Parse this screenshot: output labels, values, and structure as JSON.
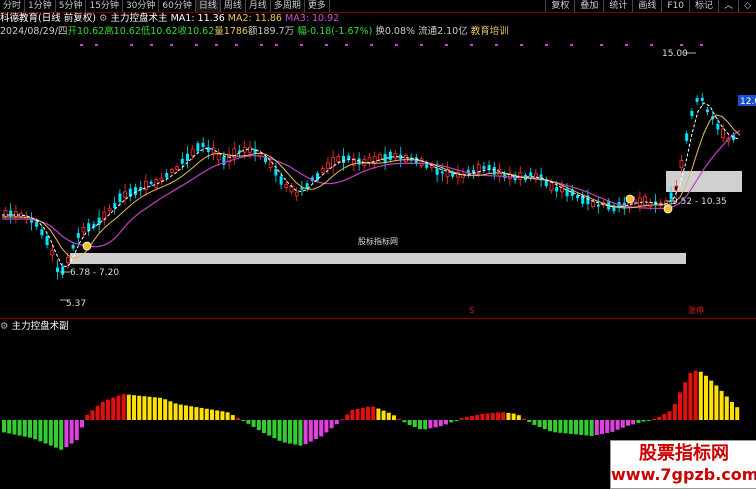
{
  "toolbar": {
    "periods": [
      "分时",
      "1分钟",
      "5分钟",
      "15分钟",
      "30分钟",
      "60分钟",
      "日线",
      "周线",
      "月线",
      "多周期",
      "更多"
    ],
    "active_period": "日线",
    "right_buttons": [
      "复权",
      "叠加",
      "统计",
      "画线",
      "F10",
      "标记"
    ],
    "right_icons": [
      "chevron-up-icon",
      "diamond-icon"
    ]
  },
  "header": {
    "stock_name": "科德教育",
    "mode": "(日线 前复权)",
    "indicator_name": "主力控盘术主",
    "ma1": "MA1: 11.36",
    "ma2": "MA2: 11.86",
    "ma3": "MA3: 10.92",
    "date": "2024/08/29/四",
    "open": "开10.62",
    "high": "高10.62",
    "low": "低10.62",
    "close": "收10.62",
    "volume": "量1786",
    "amount": "额189.7万",
    "change": "幅-0.18(-1.67%)",
    "turnover": "换0.08%",
    "float_cap": "流通2.10亿",
    "concept": "教育培训"
  },
  "annotations": {
    "high_label": "15.00",
    "low_label": "5.37",
    "band_left_label": "6.78 - 7.20",
    "band_right_label": "9.52 - 10.35",
    "price_tag": "12.0",
    "center_watermark": "股标指标网",
    "s_marker": "S",
    "tag_marker": "涨停"
  },
  "sub_panel": {
    "title": "主力控盘术副"
  },
  "watermark": {
    "line1": "股票指标网",
    "line2": "www.7gpzb.com"
  },
  "colors": {
    "background": "#000000",
    "up_candle": "#ff3030",
    "down_candle": "#00e5ff",
    "ma1": "#ffffff",
    "ma2": "#e0c060",
    "ma3": "#c040c0",
    "band": "#d0d0d0",
    "bar_red": "#e01010",
    "bar_green": "#33cc33",
    "bar_yellow": "#ffe000",
    "bar_magenta": "#e040e0"
  }
}
